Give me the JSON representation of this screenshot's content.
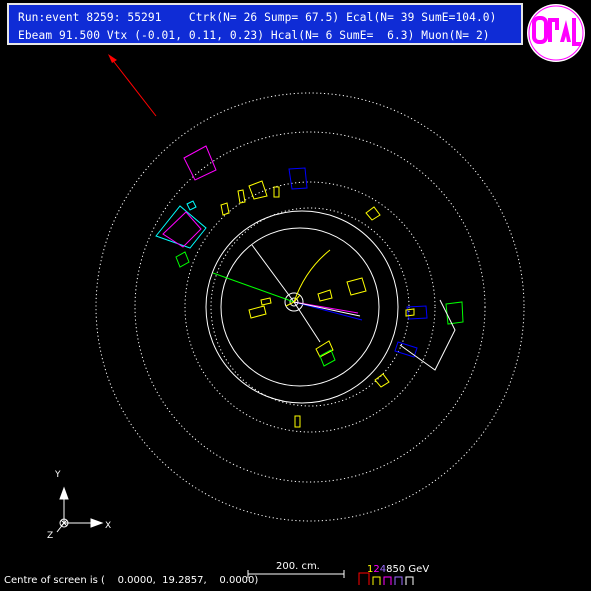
{
  "info": {
    "line1": "Run:event 8259: 55291    Ctrk(N= 26 Sump= 67.5) Ecal(N= 39 SumE=104.0)",
    "line2": "Ebeam 91.500 Vtx (-0.01, 0.11, 0.23) Hcal(N= 6 SumE=  6.3) Muon(N= 2)"
  },
  "logo": {
    "text": "OPAL",
    "color": "#ff00ff"
  },
  "axes": {
    "y": "Y",
    "x": "X",
    "z": "Z"
  },
  "scale": {
    "label": "200. cm."
  },
  "energy_scale": {
    "values": [
      "1",
      "2",
      "4",
      "8",
      "50"
    ],
    "unit": "GeV",
    "colors": [
      "#ffff00",
      "#ff00ff",
      "#9d6bff",
      "#ffffff",
      "#ffffff"
    ]
  },
  "footer": {
    "text": "Centre of screen is (    0.0000,  19.2857,    0.0000)"
  },
  "colors": {
    "tracks": "#ffff00",
    "ecal": "#ffff00",
    "hcal": "#0000ff",
    "muon": "#ff0000",
    "panel": "#0f2cd6"
  }
}
